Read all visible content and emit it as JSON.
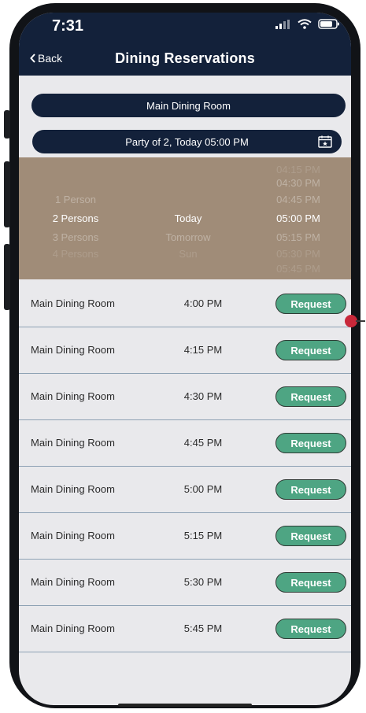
{
  "status": {
    "time": "7:31"
  },
  "header": {
    "back_label": "Back",
    "title": "Dining Reservations"
  },
  "venue_selector": {
    "label": "Main Dining Room"
  },
  "party_selector": {
    "label": "Party of 2, Today 05:00 PM"
  },
  "picker": {
    "party": [
      "1 Person",
      "2 Persons",
      "3 Persons",
      "4 Persons"
    ],
    "party_selected": "2 Persons",
    "day": [
      "Today",
      "Tomorrow",
      "Sun"
    ],
    "day_selected": "Today",
    "time": [
      "04:15 PM",
      "04:30 PM",
      "04:45 PM",
      "05:00 PM",
      "05:15 PM",
      "05:30 PM",
      "05:45 PM"
    ],
    "time_selected": "05:00 PM"
  },
  "slots": [
    {
      "room": "Main Dining Room",
      "time": "4:00 PM",
      "action": "Request"
    },
    {
      "room": "Main Dining Room",
      "time": "4:15 PM",
      "action": "Request"
    },
    {
      "room": "Main Dining Room",
      "time": "4:30 PM",
      "action": "Request"
    },
    {
      "room": "Main Dining Room",
      "time": "4:45 PM",
      "action": "Request"
    },
    {
      "room": "Main Dining Room",
      "time": "5:00 PM",
      "action": "Request"
    },
    {
      "room": "Main Dining Room",
      "time": "5:15 PM",
      "action": "Request"
    },
    {
      "room": "Main Dining Room",
      "time": "5:30 PM",
      "action": "Request"
    },
    {
      "room": "Main Dining Room",
      "time": "5:45 PM",
      "action": "Request"
    }
  ],
  "colors": {
    "navy": "#13213a",
    "picker_bg": "#a08c78",
    "request_green": "#4ea583",
    "screen_bg": "#e9e9ec"
  }
}
